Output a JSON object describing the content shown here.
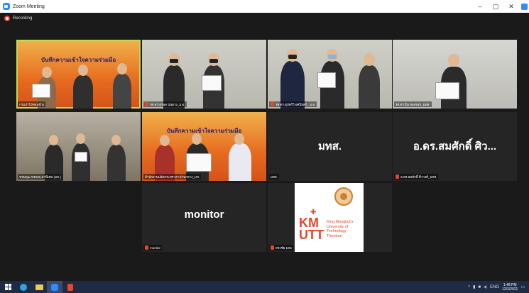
{
  "window": {
    "title": "Zoom Meeting",
    "controls": [
      "–",
      "▢",
      "✕"
    ]
  },
  "recording": {
    "label": "Recording"
  },
  "tiles": [
    {
      "id": "t1",
      "name": "กรมป่าไม้ค่อนข้าง",
      "banner": "บันทึกความเข้าใจความร่วมมือ"
    },
    {
      "id": "t2",
      "name": "รศ.ดร.สุรพล ปนดวง_ม.อ."
    },
    {
      "id": "t3",
      "name": "รศ.ดร.สุภัศร์วิ ยศปิยัสก์_ ม.อ."
    },
    {
      "id": "t4",
      "name": "รศ.ดร.ยิน ทองขจร_มทส."
    },
    {
      "id": "t5",
      "name": "ขจนพุฒ พรณจะมาพิเศษ (มข.)"
    },
    {
      "id": "t6",
      "name": "สำนักงานปลัดกระทรวงฯ ส่วนกลาง_มข.",
      "banner": "บันทึกความเข้าใจความร่วมมือ"
    },
    {
      "id": "t7",
      "name": "มทส.",
      "bigname": "มทส."
    },
    {
      "id": "t8",
      "name": "อ.ดร.สมศักดิ์ ศิววงศ์_มทส.",
      "bigname": "อ.ดร.สมศักดิ์ ศิว..."
    },
    {
      "id": "t9",
      "name": "monitor",
      "bigname": "monitor"
    },
    {
      "id": "t10",
      "name": "ทรงชัย มจธ",
      "logo_text": "King Mongkut's\nUniversity of\nTechnology\nThonburi",
      "logo_mark": "KM\nUTT"
    }
  ],
  "taskbar": {
    "tray_lang": "ENG",
    "time": "1:48 PM",
    "date": "12/2/2021"
  },
  "colors": {
    "accent": "#2d8cff",
    "active_speaker": "#c7d84c",
    "mic_muted": "#e8452c"
  }
}
